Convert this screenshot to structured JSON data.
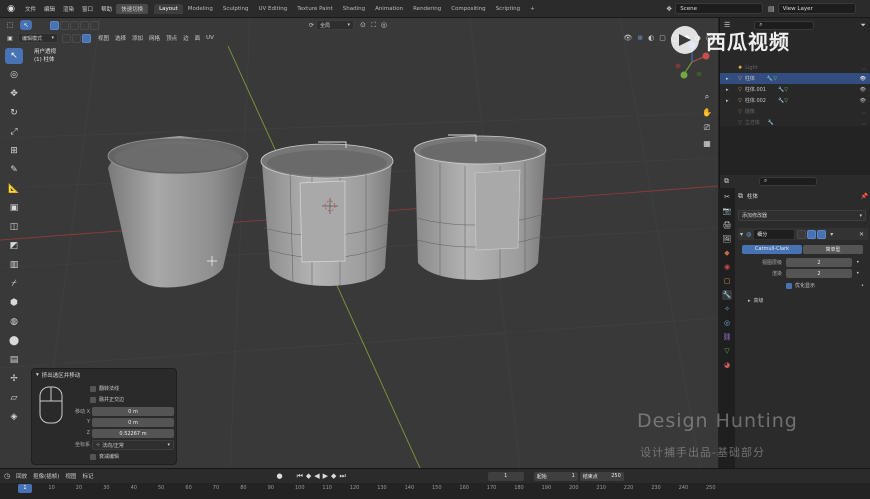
{
  "menubar": {
    "items": [
      "文件",
      "编辑",
      "渲染",
      "窗口",
      "帮助"
    ],
    "highlight": "快速切换",
    "workspaces": [
      "Layout",
      "Modeling",
      "Sculpting",
      "UV Editing",
      "Texture Paint",
      "Shading",
      "Animation",
      "Rendering",
      "Compositing",
      "Scripting"
    ],
    "active_workspace": "Layout",
    "add_tab": "+",
    "scene": "Scene",
    "view_layer": "View Layer"
  },
  "viewport_header": {
    "mode": "编辑模式",
    "menus": [
      "视图",
      "选择",
      "添加",
      "网格",
      "顶点",
      "边",
      "面",
      "UV"
    ],
    "orientation": "全局",
    "view_label": "用户透视",
    "object_label": "(1) 柱体"
  },
  "toolbar": {
    "icons": [
      "select-box-icon",
      "cursor-icon",
      "move-icon",
      "rotate-icon",
      "scale-icon",
      "transform-icon",
      "annotate-icon",
      "measure-icon",
      "extrude-icon",
      "inset-icon",
      "bevel-icon",
      "loop-cut-icon",
      "knife-icon",
      "poly-build-icon",
      "spin-icon",
      "smooth-icon",
      "edge-slide-icon",
      "shrink-fatten-icon",
      "shear-icon",
      "rip-icon"
    ]
  },
  "operator_panel": {
    "title": "挤出选区并移动",
    "flip_normals": "翻转法线",
    "dissolve_orthogonal": "融并正交边",
    "move_label": "移动",
    "x_label": "X",
    "x_value": "0 m",
    "y_label": "Y",
    "y_value": "0 m",
    "z_label": "Z",
    "z_value": "0.52267 m",
    "coord_label": "坐标系",
    "coord_value": "法向/正常",
    "proportional": "衰减编辑"
  },
  "outliner": {
    "items": [
      {
        "name": "Light",
        "dim": true
      },
      {
        "name": "柱体",
        "dim": false,
        "selected": true
      },
      {
        "name": "柱体.001",
        "dim": false
      },
      {
        "name": "柱体.002",
        "dim": false
      },
      {
        "name": "摄像",
        "dim": true
      },
      {
        "name": "立方体",
        "dim": true
      }
    ]
  },
  "properties": {
    "object_name": "柱体",
    "add_modifier": "添加修改器",
    "modifier_name": "细分",
    "tab_catmull": "Catmull-Clark",
    "tab_simple": "简单型",
    "viewport_levels_label": "视图层级",
    "viewport_levels": "2",
    "render_label": "渲染",
    "render_levels": "2",
    "optimal_display": "优化显示",
    "advanced": "高级"
  },
  "timeline": {
    "playback": "回放",
    "keying": "抠像(插帧)",
    "view": "视图",
    "marker": "标记",
    "current_frame": "1",
    "start_label": "起始",
    "start": "1",
    "end_label": "结束点",
    "end": "250",
    "ticks": [
      "1",
      "10",
      "20",
      "30",
      "40",
      "50",
      "60",
      "70",
      "80",
      "90",
      "100",
      "110",
      "120",
      "130",
      "140",
      "150",
      "160",
      "170",
      "180",
      "190",
      "200",
      "210",
      "220",
      "230",
      "240",
      "250"
    ]
  },
  "watermark": {
    "line1": "Design Hunting",
    "line2": "设计捕手出品-基础部分",
    "brand": "西瓜视频"
  },
  "colors": {
    "accent": "#4772b3",
    "viewport_bg": "#393939",
    "panel_bg": "#2b2b2b",
    "selected_row": "#334d80"
  }
}
